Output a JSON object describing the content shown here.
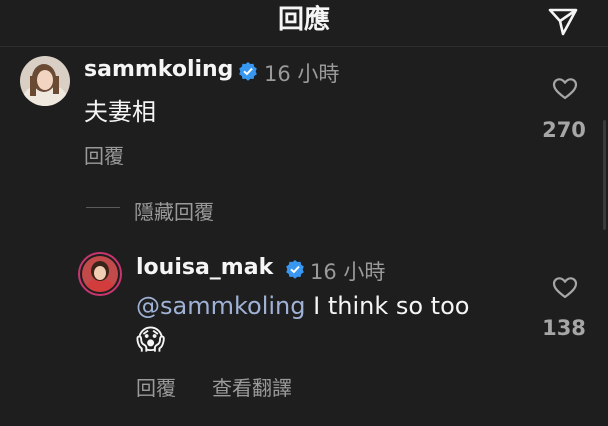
{
  "header": {
    "title": "回應"
  },
  "comments": [
    {
      "username": "sammkoling",
      "timestamp": "16 小時",
      "text": "夫妻相",
      "reply_label": "回覆",
      "likes": "270"
    }
  ],
  "hide_replies_label": "隱藏回覆",
  "reply": {
    "username": "louisa_mak",
    "timestamp": "16 小時",
    "mention": "@sammkoling",
    "text": " I think so too",
    "emoji": "😱",
    "reply_label": "回覆",
    "translate_label": "查看翻譯",
    "likes": "138"
  },
  "colors": {
    "background": "#1e1e1e",
    "verified": "#3897f0",
    "mention": "#9fb2d6",
    "muted_text": "#9a9a9a",
    "story_ring": "#c9356e"
  }
}
